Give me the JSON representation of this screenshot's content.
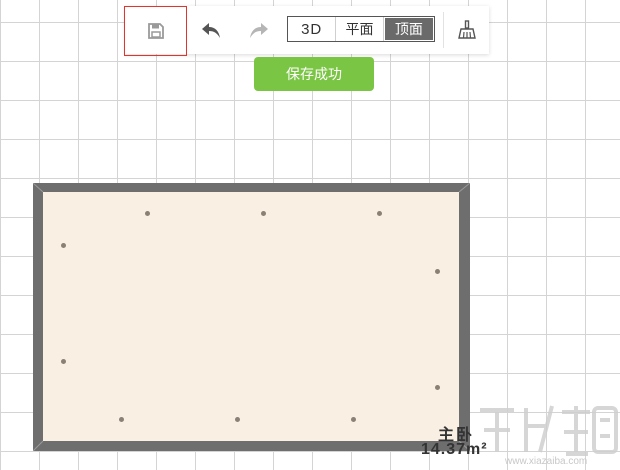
{
  "toolbar": {
    "save_icon": "floppy-disk-icon",
    "undo_icon": "undo-arrow-icon",
    "redo_icon": "redo-arrow-icon",
    "clean_icon": "broom-icon",
    "view_modes": {
      "three_d": "3D",
      "plan": "平面",
      "top": "顶面"
    },
    "active_view": "顶面",
    "highlight_color": "#e0342f"
  },
  "toast": {
    "message": "保存成功",
    "color": "#7bc545"
  },
  "room": {
    "name": "主卧",
    "area": "14.37",
    "area_unit": "m²",
    "wall_color": "#6e6e6e",
    "floor_color": "#f9efe2"
  },
  "watermark": {
    "site": "www.xiazaiba.com"
  }
}
